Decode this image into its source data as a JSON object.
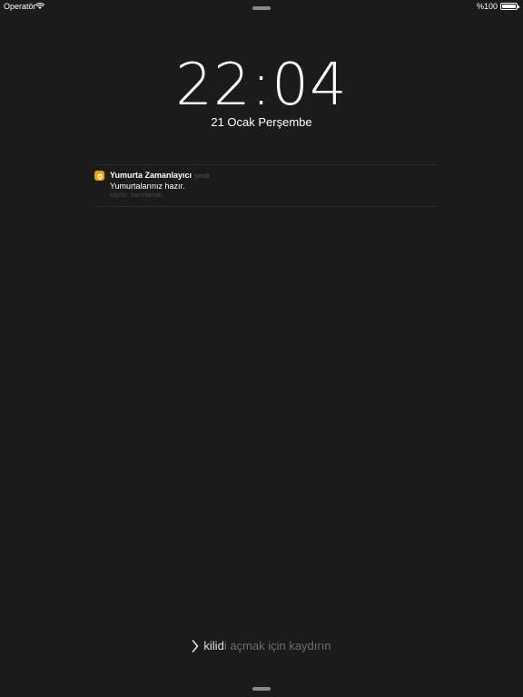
{
  "status_bar": {
    "carrier": "Operatör",
    "wifi_icon": "wifi-icon",
    "battery_text": "%100",
    "battery_icon": "battery-full-icon",
    "battery_level": 1.0
  },
  "lock_screen": {
    "time": "22:04",
    "date": "21 Ocak Perşembe"
  },
  "notification": {
    "app_icon": "egg-timer-app-icon",
    "app_color": "#f5a300",
    "title": "Yumurta Zamanlayıcı",
    "time": "şimdi",
    "body": "Yumurtalarınız hazır.",
    "action_hint": "kaydır: hazırlamak"
  },
  "unlock": {
    "chevron_icon": "chevron-right-icon",
    "text_bright": "kilid",
    "text_dim": "i açmak için kaydırın"
  }
}
